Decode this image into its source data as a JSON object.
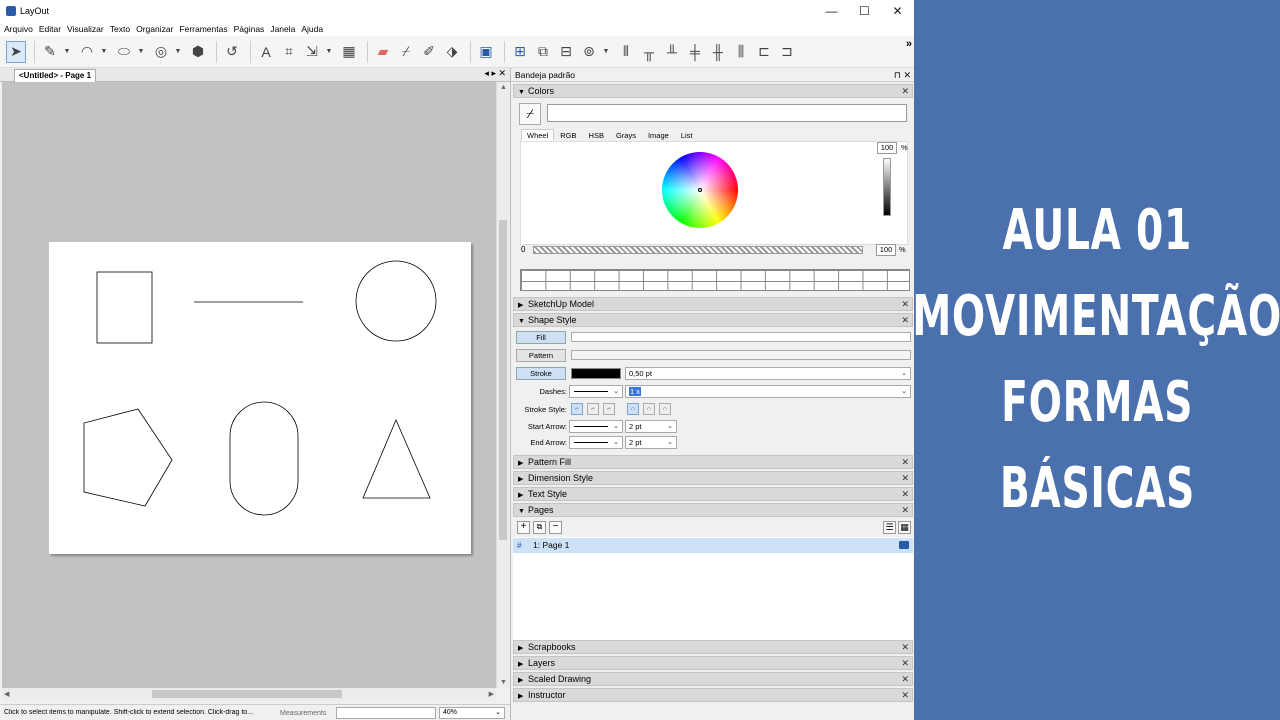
{
  "window": {
    "title": "LayOut",
    "min": "—",
    "max": "☐",
    "close": "✕"
  },
  "menu": [
    "Arquivo",
    "Editar",
    "Visualizar",
    "Texto",
    "Organizar",
    "Ferramentas",
    "Páginas",
    "Janela",
    "Ajuda"
  ],
  "toolbar": {
    "icons": [
      "select-tool",
      "pencil-tool",
      "arc-tool",
      "shape-tool",
      "offset-tool",
      "paint-bucket",
      "text-tool",
      "label-tool",
      "dimension-tool",
      "table-tool",
      "eraser-tool",
      "eyedropper",
      "style-tool",
      "split-tool",
      "presentation",
      "add-page",
      "duplicate-page",
      "delete-page",
      "scrapbook",
      "align",
      "distribute"
    ],
    "overflow": "»"
  },
  "document": {
    "tab_label": "<Untitled> - Page 1",
    "tab_arrows": "◂ ▸ ✕"
  },
  "status": {
    "text": "Click to select items to manipulate. Shift-click to extend selection. Click-drag to...",
    "measurements_label": "Measurements",
    "measurements_value": "",
    "zoom": "40%"
  },
  "tray": {
    "title": "Bandeja padrão",
    "controls": "⊓ ✕",
    "colors": {
      "header": "Colors",
      "tabs": [
        "Wheel",
        "RGB",
        "HSB",
        "Grays",
        "Image",
        "List"
      ],
      "brightness": "100",
      "opacity": "100",
      "percent": "%",
      "zero": "0"
    },
    "sketchup_model": "SketchUp Model",
    "shape_style": {
      "header": "Shape Style",
      "fill": "Fill",
      "pattern": "Pattern",
      "stroke": "Stroke",
      "stroke_color": "#000000",
      "stroke_width": "0,50 pt",
      "dashes_label": "Dashes:",
      "dash_scale": "1 x",
      "stroke_style_label": "Stroke Style:",
      "start_arrow_label": "Start Arrow:",
      "start_arrow_size": "2 pt",
      "end_arrow_label": "End Arrow:",
      "end_arrow_size": "2 pt"
    },
    "pattern_fill": "Pattern Fill",
    "dimension_style": "Dimension Style",
    "text_style": "Text Style",
    "pages": {
      "header": "Pages",
      "items": [
        {
          "hash": "#",
          "label": "1:  Page 1"
        }
      ]
    },
    "scrapbooks": "Scrapbooks",
    "layers": "Layers",
    "scaled_drawing": "Scaled Drawing",
    "instructor": "Instructor"
  },
  "overlay": {
    "lines": [
      "AULA 01",
      "MOVIMENTAÇÃO",
      "FORMAS",
      "BÁSICAS"
    ],
    "bg": "#4a70ad"
  }
}
